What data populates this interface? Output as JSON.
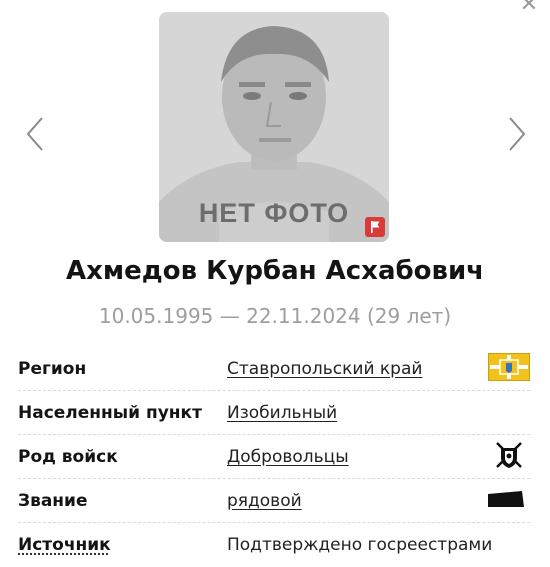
{
  "photo": {
    "placeholder_label": "НЕТ ФОТО"
  },
  "person": {
    "name": "Ахмедов Курбан Асхабович",
    "dates": "10.05.1995 — 22.11.2024 (29 лет)"
  },
  "details": {
    "region": {
      "label": "Регион",
      "value": "Ставропольский край",
      "icon": "region-coat-of-arms-icon"
    },
    "locality": {
      "label": "Населенный пункт",
      "value": "Изобильный"
    },
    "branch": {
      "label": "Род войск",
      "value": "Добровольцы",
      "icon": "volunteers-emblem-icon"
    },
    "rank": {
      "label": "Звание",
      "value": "рядовой",
      "icon": "rank-insignia-icon"
    },
    "source": {
      "label": "Источник",
      "value": "Подтверждено госреестрами"
    }
  },
  "colors": {
    "flag_button": "#d93a3a",
    "dates_gray": "#9e9e9e",
    "region_yellow": "#f2c21a"
  }
}
